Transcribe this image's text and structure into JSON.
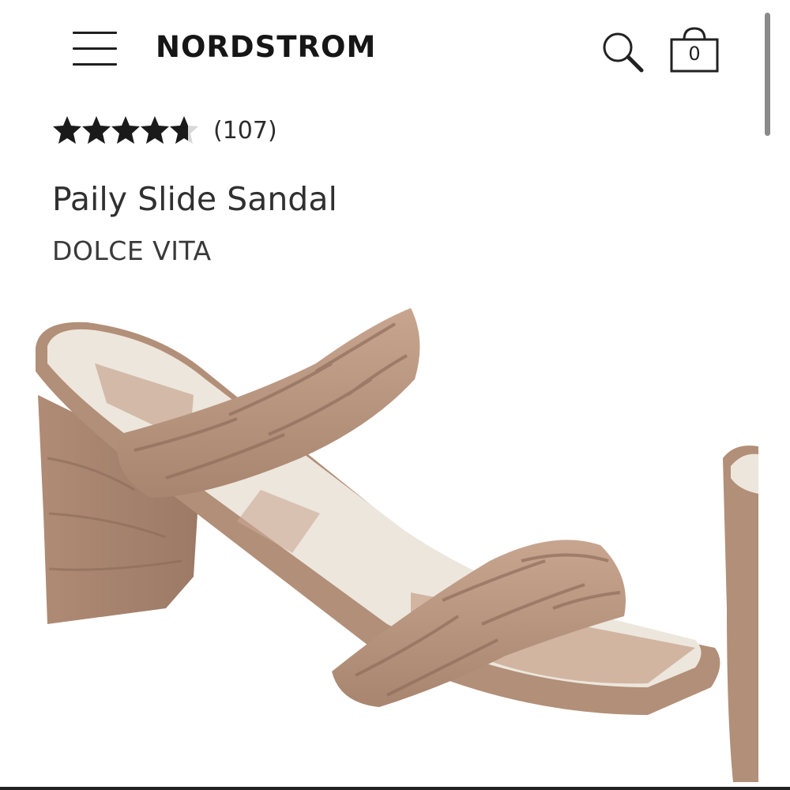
{
  "header": {
    "brand": "NORDSTROM",
    "bag_count": "0",
    "icons": [
      "menu-icon",
      "search-icon",
      "bag-icon"
    ]
  },
  "product": {
    "rating": 4.5,
    "rating_max": 5,
    "review_count": "(107)",
    "title": "Paily Slide Sandal",
    "brand": "DOLCE VITA"
  },
  "colors": {
    "text": "#222222",
    "star": "#1a1a1a",
    "sandal": "#b79680"
  }
}
